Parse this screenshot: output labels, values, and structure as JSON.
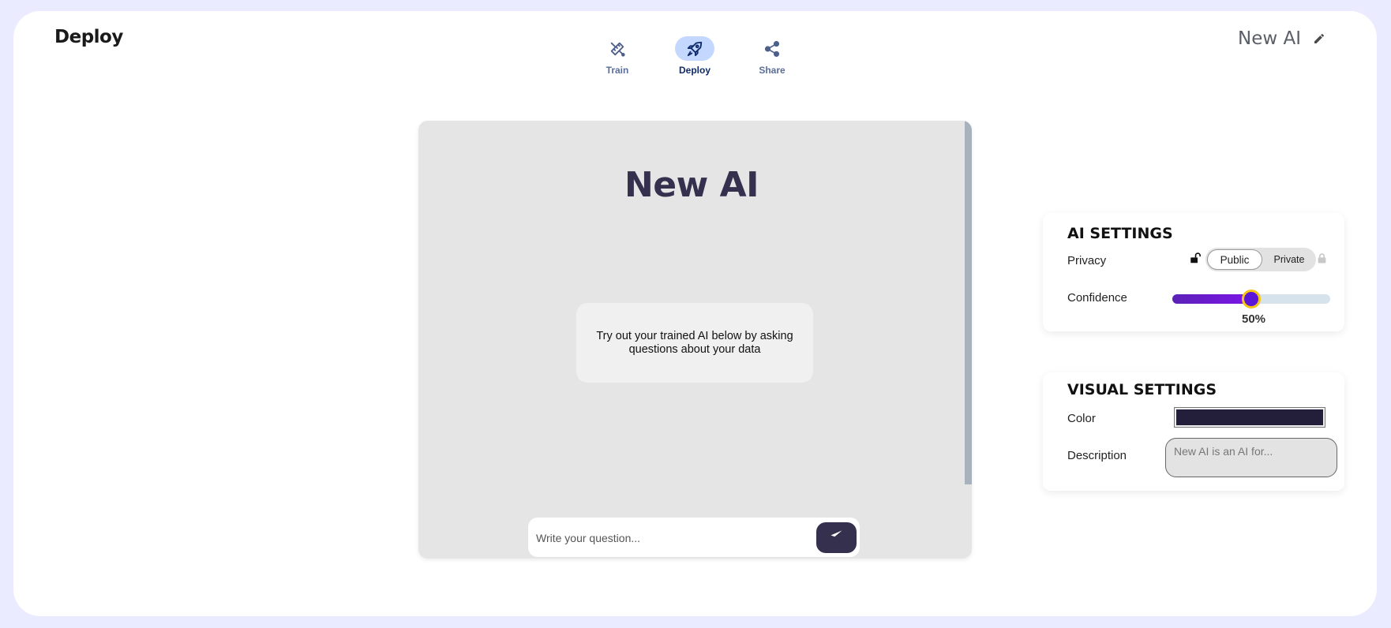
{
  "header": {
    "page_title": "Deploy",
    "ai_name": "New AI"
  },
  "nav": {
    "items": [
      {
        "label": "Train",
        "icon": "wrench-ruler-icon"
      },
      {
        "label": "Deploy",
        "icon": "rocket-icon",
        "active": true
      },
      {
        "label": "Share",
        "icon": "share-icon"
      }
    ]
  },
  "chat": {
    "title": "New AI",
    "intro": "Try out your trained AI below by asking questions about your data",
    "input_placeholder": "Write your question...",
    "send_icon": "paper-plane-icon"
  },
  "ai_settings": {
    "heading": "AI SETTINGS",
    "privacy_label": "Privacy",
    "privacy_options": [
      "Public",
      "Private"
    ],
    "privacy_selected": "Public",
    "confidence_label": "Confidence",
    "confidence_value": 50,
    "confidence_display": "50%"
  },
  "visual_settings": {
    "heading": "VISUAL SETTINGS",
    "color_label": "Color",
    "color_value": "#231f3a",
    "description_label": "Description",
    "description_placeholder": "New AI is an AI for..."
  },
  "colors": {
    "background": "#ebebff",
    "chat_panel": "#e5e5e5",
    "brand_dark": "#34304d",
    "active_nav": "#c4d7ff",
    "slider_fill": "#7c14e8",
    "slider_thumb_ring": "#f5c518"
  }
}
